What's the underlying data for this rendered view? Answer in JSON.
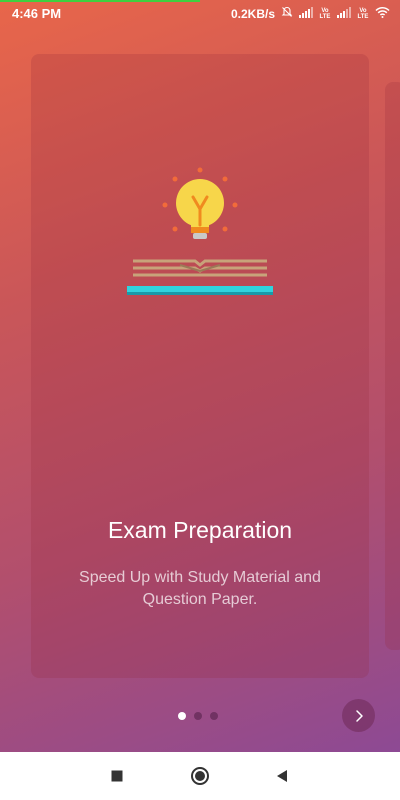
{
  "status_bar": {
    "time": "4:46 PM",
    "net_speed": "0.2KB/s",
    "mute_icon": "bell-off-icon",
    "signal_icon": "signal-bars-icon",
    "volte_tag": "Vo LTE",
    "wifi_icon": "wifi-icon"
  },
  "onboarding": {
    "illustration_icon": "lightbulb-book-icon",
    "title": "Exam Preparation",
    "subtitle": "Speed Up with Study Material and Question Paper.",
    "page_indicator": {
      "total": 3,
      "active": 1
    },
    "next_icon": "chevron-right-icon"
  },
  "nav_bar": {
    "recents_icon": "square-icon",
    "home_icon": "circle-home-icon",
    "back_icon": "triangle-back-icon"
  },
  "colors": {
    "gradient_top": "#e8664a",
    "gradient_bottom": "#8d4a94",
    "bulb": "#f7d64a",
    "page_base": "#2fd4de"
  }
}
